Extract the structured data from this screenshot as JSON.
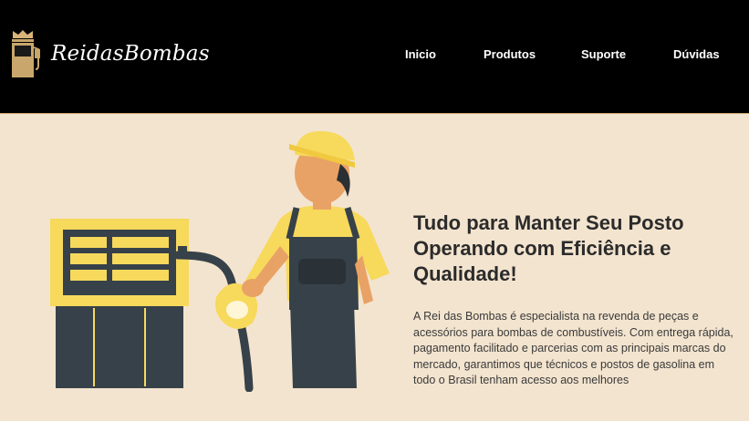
{
  "brand": {
    "name": "ReidasBombas"
  },
  "nav": {
    "items": [
      {
        "label": "Inicio"
      },
      {
        "label": "Produtos"
      },
      {
        "label": "Suporte"
      },
      {
        "label": "Dúvidas"
      }
    ]
  },
  "hero": {
    "title": "Tudo para Manter Seu Posto Operando com Eficiência e Qualidade!",
    "body": "A Rei das Bombas é especialista na revenda de peças e acessórios para bombas de combustíveis. Com entrega rápida, pagamento facilitado e parcerias com as principais marcas do mercado, garantimos que técnicos e postos de gasolina em todo o Brasil tenham acesso aos melhores",
    "illustration_icon": "gas-station-worker-illustration"
  },
  "colors": {
    "header_bg": "#000000",
    "page_bg": "#f3e4cf",
    "accent_yellow": "#f7d95c",
    "dark_slate": "#374149",
    "skin": "#e9a265",
    "gold": "#c9a66b"
  }
}
